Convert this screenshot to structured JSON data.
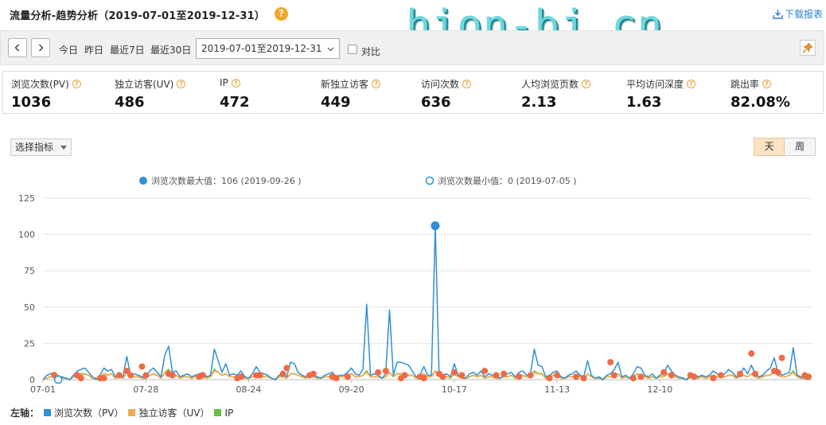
{
  "header": {
    "title": "流量分析-趋势分析（2019-07-01至2019-12-31）",
    "help_mark": "?",
    "watermark": "hion-bj.cn",
    "download_label": "下载报表"
  },
  "toolbar": {
    "shortcuts": [
      "今日",
      "昨日",
      "最近7日",
      "最近30日"
    ],
    "date_range": "2019-07-01至2019-12-31",
    "compare_label": "对比"
  },
  "metrics": [
    {
      "label": "浏览次数(PV)",
      "value": "1036"
    },
    {
      "label": "独立访客(UV)",
      "value": "486"
    },
    {
      "label": "IP",
      "value": "472"
    },
    {
      "label": "新独立访客",
      "value": "449"
    },
    {
      "label": "访问次数",
      "value": "636"
    },
    {
      "label": "人均浏览页数",
      "value": "2.13"
    },
    {
      "label": "平均访问深度",
      "value": "1.63"
    },
    {
      "label": "跳出率",
      "value": "82.08%"
    }
  ],
  "controls": {
    "indicator_select": "选择指标",
    "granularity": [
      {
        "label": "天",
        "active": true
      },
      {
        "label": "周",
        "active": false
      }
    ]
  },
  "chart_data": {
    "type": "line",
    "x_tick_labels": [
      "07-01",
      "07-28",
      "08-24",
      "09-20",
      "10-17",
      "11-13",
      "12-10"
    ],
    "y_tick_labels": [
      "0",
      "25",
      "50",
      "75",
      "100",
      "125"
    ],
    "ylim": [
      0,
      125
    ],
    "grid": "horizontal",
    "legend_top": [
      {
        "label": "浏览次数最大值：106 (2019-09-26 )",
        "marker": "filled",
        "color": "#2f8fd8"
      },
      {
        "label": "浏览次数最小值：0 (2019-07-05 )",
        "marker": "hollow",
        "color": "#2f8fd8"
      }
    ],
    "axis_legend_title": "左轴：",
    "series": [
      {
        "name": "浏览次数（PV）",
        "color": "#2f8fd8",
        "values": [
          0,
          3,
          4,
          5,
          0,
          2,
          1,
          0,
          3,
          6,
          7,
          8,
          5,
          2,
          0,
          3,
          8,
          6,
          7,
          2,
          3,
          2,
          16,
          3,
          4,
          3,
          2,
          1,
          6,
          8,
          5,
          2,
          17,
          23,
          5,
          6,
          2,
          3,
          4,
          2,
          3,
          4,
          5,
          2,
          3,
          21,
          13,
          5,
          11,
          3,
          4,
          3,
          6,
          2,
          1,
          4,
          9,
          5,
          4,
          3,
          1,
          0,
          3,
          4,
          2,
          12,
          11,
          5,
          3,
          2,
          4,
          3,
          2,
          1,
          3,
          4,
          5,
          2,
          3,
          3,
          5,
          8,
          4,
          3,
          7,
          52,
          3,
          4,
          3,
          1,
          4,
          48,
          3,
          12,
          12,
          11,
          10,
          6,
          2,
          3,
          9,
          3,
          3,
          106,
          4,
          3,
          4,
          2,
          11,
          3,
          2,
          1,
          4,
          5,
          3,
          6,
          2,
          4,
          3,
          2,
          1,
          3,
          4,
          5,
          2,
          5,
          6,
          3,
          4,
          21,
          10,
          9,
          2,
          3,
          5,
          6,
          2,
          1,
          3,
          4,
          6,
          3,
          2,
          13,
          3,
          1,
          2,
          0,
          3,
          4,
          7,
          12,
          2,
          3,
          1,
          4,
          9,
          8,
          3,
          2,
          4,
          1,
          3,
          4,
          10,
          6,
          3,
          2,
          1,
          0,
          3,
          4,
          2,
          3,
          2,
          3,
          6,
          4,
          3,
          4,
          7,
          5,
          2,
          3,
          8,
          4,
          10,
          4,
          2,
          3,
          6,
          8,
          15,
          5,
          3,
          4,
          5,
          22,
          3,
          2,
          1,
          0
        ]
      },
      {
        "name": "独立访客（UV）",
        "color": "#f0ad4e",
        "values": [
          0,
          1,
          2,
          3,
          1,
          1,
          1,
          0,
          2,
          3,
          3,
          4,
          3,
          1,
          1,
          2,
          4,
          3,
          4,
          1,
          2,
          1,
          5,
          2,
          2,
          2,
          1,
          1,
          3,
          4,
          3,
          1,
          5,
          6,
          3,
          3,
          1,
          2,
          2,
          1,
          2,
          2,
          3,
          1,
          2,
          6,
          5,
          3,
          4,
          2,
          2,
          2,
          3,
          1,
          1,
          2,
          4,
          3,
          2,
          2,
          1,
          0,
          2,
          2,
          1,
          4,
          4,
          3,
          2,
          1,
          2,
          2,
          1,
          1,
          2,
          2,
          3,
          1,
          2,
          2,
          3,
          4,
          2,
          2,
          3,
          5,
          2,
          2,
          2,
          1,
          2,
          5,
          2,
          4,
          4,
          4,
          3,
          3,
          1,
          2,
          4,
          2,
          2,
          6,
          2,
          2,
          2,
          1,
          4,
          2,
          1,
          1,
          2,
          3,
          2,
          3,
          1,
          2,
          2,
          1,
          1,
          2,
          2,
          3,
          1,
          3,
          3,
          2,
          2,
          5,
          4,
          4,
          1,
          2,
          3,
          3,
          1,
          1,
          2,
          2,
          3,
          2,
          1,
          4,
          2,
          1,
          1,
          0,
          2,
          2,
          3,
          4,
          1,
          2,
          1,
          2,
          4,
          3,
          2,
          1,
          2,
          1,
          2,
          2,
          4,
          3,
          2,
          1,
          1,
          0,
          2,
          2,
          1,
          2,
          1,
          2,
          3,
          2,
          2,
          2,
          3,
          3,
          1,
          2,
          3,
          2,
          4,
          2,
          1,
          2,
          3,
          3,
          5,
          3,
          2,
          2,
          3,
          5,
          2,
          1,
          1,
          0
        ]
      },
      {
        "name": "IP",
        "color": "#6bbf3a",
        "values": [
          0,
          1,
          2,
          3,
          1,
          1,
          1,
          0,
          2,
          3,
          4,
          4,
          3,
          1,
          1,
          2,
          4,
          3,
          4,
          1,
          2,
          1,
          5,
          2,
          2,
          2,
          1,
          1,
          3,
          4,
          3,
          1,
          5,
          7,
          3,
          3,
          1,
          2,
          2,
          1,
          2,
          2,
          3,
          1,
          2,
          7,
          5,
          3,
          4,
          2,
          2,
          2,
          3,
          1,
          1,
          2,
          4,
          3,
          2,
          2,
          1,
          0,
          2,
          2,
          1,
          4,
          4,
          3,
          2,
          1,
          2,
          2,
          1,
          1,
          2,
          2,
          3,
          1,
          2,
          2,
          3,
          4,
          2,
          2,
          3,
          6,
          2,
          2,
          2,
          1,
          2,
          5,
          2,
          4,
          4,
          4,
          3,
          3,
          1,
          2,
          4,
          2,
          2,
          6,
          2,
          2,
          2,
          1,
          4,
          2,
          1,
          1,
          2,
          3,
          2,
          3,
          1,
          2,
          2,
          1,
          1,
          2,
          2,
          3,
          1,
          3,
          3,
          2,
          2,
          6,
          4,
          4,
          1,
          2,
          3,
          3,
          1,
          1,
          2,
          2,
          3,
          2,
          1,
          4,
          2,
          1,
          1,
          0,
          2,
          2,
          3,
          4,
          1,
          2,
          1,
          2,
          4,
          3,
          2,
          1,
          2,
          1,
          2,
          2,
          4,
          3,
          2,
          1,
          1,
          0,
          2,
          2,
          1,
          2,
          1,
          2,
          3,
          2,
          2,
          2,
          3,
          3,
          1,
          2,
          3,
          2,
          4,
          2,
          1,
          2,
          3,
          3,
          6,
          3,
          2,
          2,
          3,
          6,
          2,
          1,
          1,
          0
        ]
      }
    ],
    "highlight_points": [
      {
        "day": 3,
        "value": 3
      },
      {
        "day": 4,
        "value": 1
      },
      {
        "day": 9,
        "value": 3
      },
      {
        "day": 10,
        "value": 1
      },
      {
        "day": 15,
        "value": 1
      },
      {
        "day": 16,
        "value": 1
      },
      {
        "day": 20,
        "value": 3
      },
      {
        "day": 22,
        "value": 6
      },
      {
        "day": 23,
        "value": 3
      },
      {
        "day": 26,
        "value": 9
      },
      {
        "day": 27,
        "value": 3
      },
      {
        "day": 33,
        "value": 4
      },
      {
        "day": 34,
        "value": 3
      },
      {
        "day": 41,
        "value": 2
      },
      {
        "day": 42,
        "value": 3
      },
      {
        "day": 51,
        "value": 1
      },
      {
        "day": 52,
        "value": 2
      },
      {
        "day": 56,
        "value": 3
      },
      {
        "day": 57,
        "value": 3
      },
      {
        "day": 63,
        "value": 4
      },
      {
        "day": 64,
        "value": 8
      },
      {
        "day": 70,
        "value": 3
      },
      {
        "day": 71,
        "value": 4
      },
      {
        "day": 76,
        "value": 2
      },
      {
        "day": 77,
        "value": 1
      },
      {
        "day": 80,
        "value": 2
      },
      {
        "day": 88,
        "value": 5
      },
      {
        "day": 90,
        "value": 6
      },
      {
        "day": 94,
        "value": 1
      },
      {
        "day": 95,
        "value": 3
      },
      {
        "day": 99,
        "value": 2
      },
      {
        "day": 100,
        "value": 1
      },
      {
        "day": 104,
        "value": 4
      },
      {
        "day": 105,
        "value": 2
      },
      {
        "day": 108,
        "value": 5
      },
      {
        "day": 110,
        "value": 3
      },
      {
        "day": 116,
        "value": 6
      },
      {
        "day": 119,
        "value": 3
      },
      {
        "day": 121,
        "value": 4
      },
      {
        "day": 125,
        "value": 2
      },
      {
        "day": 128,
        "value": 3
      },
      {
        "day": 133,
        "value": 1
      },
      {
        "day": 135,
        "value": 3
      },
      {
        "day": 140,
        "value": 2
      },
      {
        "day": 142,
        "value": 1
      },
      {
        "day": 149,
        "value": 12
      },
      {
        "day": 150,
        "value": 3
      },
      {
        "day": 155,
        "value": 1
      },
      {
        "day": 157,
        "value": 2
      },
      {
        "day": 163,
        "value": 5
      },
      {
        "day": 165,
        "value": 3
      },
      {
        "day": 170,
        "value": 3
      },
      {
        "day": 171,
        "value": 2
      },
      {
        "day": 176,
        "value": 1
      },
      {
        "day": 178,
        "value": 3
      },
      {
        "day": 183,
        "value": 4
      },
      {
        "day": 186,
        "value": 18
      },
      {
        "day": 187,
        "value": 4
      },
      {
        "day": 192,
        "value": 6
      },
      {
        "day": 193,
        "value": 5
      },
      {
        "day": 194,
        "value": 15
      },
      {
        "day": 200,
        "value": 3
      },
      {
        "day": 201,
        "value": 2
      }
    ]
  },
  "colors": {
    "pv": "#2f8fd8",
    "uv": "#f0ad4e",
    "ip": "#6bbf3a",
    "marker": "#f06a45",
    "accent": "#2a7fd4"
  }
}
